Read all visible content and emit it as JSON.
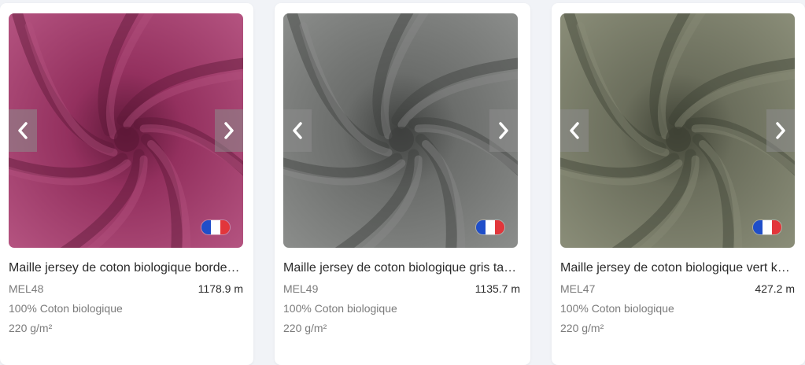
{
  "products": [
    {
      "title": "Maille jersey de coton biologique borde…",
      "ref": "MEL48",
      "length": "1178.9 m",
      "composition": "100% Coton biologique",
      "weight": "220 g/m²",
      "color": "#93305e",
      "shade": "#5e1838",
      "highlight": "#b45380",
      "flag_colors": [
        "#1f4ec9",
        "#ffffff",
        "#e2363b"
      ],
      "prev_icon": "chevron-left-icon",
      "next_icon": "chevron-right-icon"
    },
    {
      "title": "Maille jersey de coton biologique gris ta…",
      "ref": "MEL49",
      "length": "1135.7 m",
      "composition": "100% Coton biologique",
      "weight": "220 g/m²",
      "color": "#6b6d6b",
      "shade": "#3e403e",
      "highlight": "#8b8d8b",
      "flag_colors": [
        "#1f4ec9",
        "#ffffff",
        "#e2363b"
      ],
      "prev_icon": "chevron-left-icon",
      "next_icon": "chevron-right-icon"
    },
    {
      "title": "Maille jersey de coton biologique vert k…",
      "ref": "MEL47",
      "length": "427.2 m",
      "composition": "100% Coton biologique",
      "weight": "220 g/m²",
      "color": "#6b6e5c",
      "shade": "#3f4235",
      "highlight": "#8a8d78",
      "flag_colors": [
        "#1f4ec9",
        "#ffffff",
        "#e2363b"
      ],
      "prev_icon": "chevron-left-icon",
      "next_icon": "chevron-right-icon"
    }
  ]
}
